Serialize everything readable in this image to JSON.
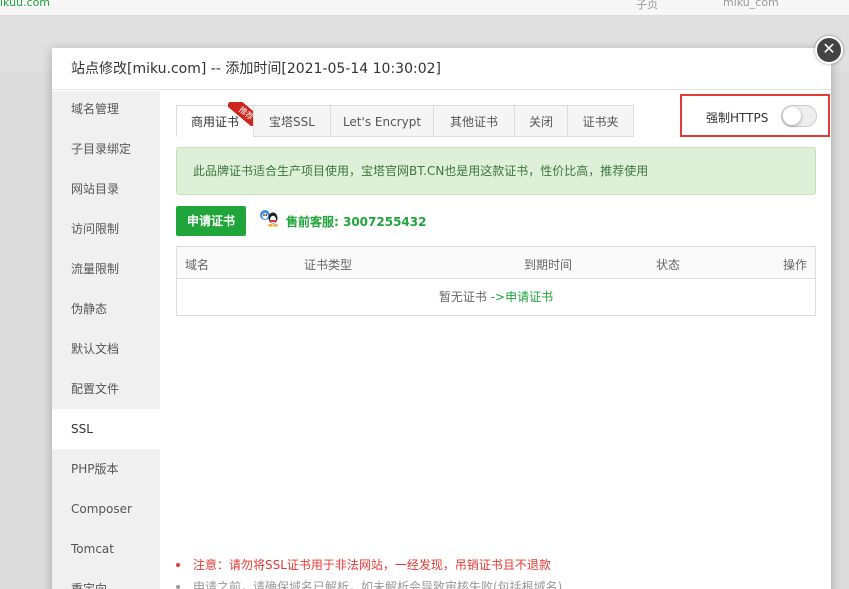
{
  "background": {
    "top_left_fragment": "ikuu.com",
    "top_mid_fragment": "子页",
    "top_right_fragment": "miku_com"
  },
  "modal": {
    "title": "站点修改[miku.com] -- 添加时间[2021-05-14 10:30:02]",
    "close_glyph": "✕"
  },
  "sidebar": {
    "items": [
      {
        "label": "域名管理"
      },
      {
        "label": "子目录绑定"
      },
      {
        "label": "网站目录"
      },
      {
        "label": "访问限制"
      },
      {
        "label": "流量限制"
      },
      {
        "label": "伪静态"
      },
      {
        "label": "默认文档"
      },
      {
        "label": "配置文件"
      },
      {
        "label": "SSL"
      },
      {
        "label": "PHP版本"
      },
      {
        "label": "Composer"
      },
      {
        "label": "Tomcat"
      },
      {
        "label": "重定向"
      }
    ],
    "active": "SSL"
  },
  "tabs": [
    {
      "label": "商用证书"
    },
    {
      "label": "宝塔SSL"
    },
    {
      "label": "Let's Encrypt"
    },
    {
      "label": "其他证书"
    },
    {
      "label": "关闭"
    },
    {
      "label": "证书夹"
    }
  ],
  "ribbon": "推荐",
  "https": {
    "label": "强制HTTPS",
    "enabled": false
  },
  "notice": "此品牌证书适合生产项目使用，宝塔官网BT.CN也是用这款证书，性价比高，推荐使用",
  "apply_button": "申请证书",
  "support": "售前客服: 3007255432",
  "table": {
    "headers": [
      "域名",
      "证书类型",
      "到期时间",
      "状态",
      "操作"
    ],
    "empty_text": "暂无证书",
    "empty_link": "->申请证书"
  },
  "tips": [
    "注意：请勿将SSL证书用于非法网站，一经发现，吊销证书且不退款",
    "申请之前，请确保域名已解析，如未解析会导致审核失败(包括根域名)"
  ],
  "colors": {
    "accent": "#20a53a",
    "danger": "#e53935",
    "notice_bg": "#dff0d8"
  }
}
